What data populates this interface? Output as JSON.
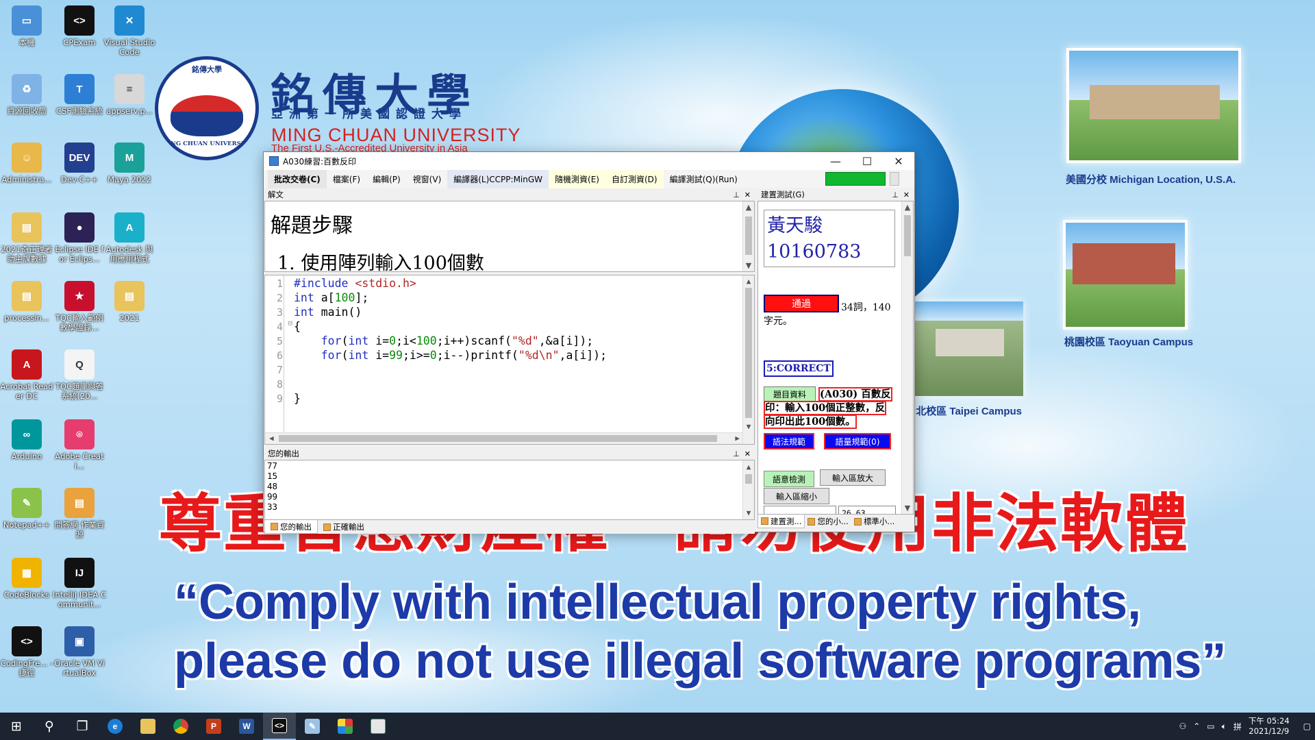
{
  "wallpaper": {
    "university_cn": "銘傳大學",
    "university_sub": "亞洲第一所美國認證大學",
    "university_en": "MING CHUAN UNIVERSITY",
    "university_en2": "The First U.S.-Accredited University in Asia",
    "seal_top": "銘傳大學",
    "seal_bottom": "MING CHUAN UNIVERSITY",
    "campus_michigan": "美國分校 Michigan Location, U.S.A.",
    "campus_taoyuan": "桃園校區 Taoyuan Campus",
    "campus_taipei": "台北校區 Taipei Campus",
    "banner_cn": "尊重智慧財產權　請勿使用非法軟體",
    "banner_en_line1": "“Comply with intellectual property rights,",
    "banner_en_line2": "please do not use illegal software programs”"
  },
  "desktop_icons": [
    {
      "label": "本機",
      "icon": "pc-icon",
      "color": "#4a90d9",
      "glyph": "▭"
    },
    {
      "label": "CPExam",
      "icon": "cpexam-icon",
      "color": "#111111",
      "glyph": "<>"
    },
    {
      "label": "Visual Studio Code",
      "icon": "vscode-icon",
      "color": "#1f8ad2",
      "glyph": "✕"
    },
    {
      "label": "資源回收筒",
      "icon": "recycle-bin-icon",
      "color": "#7fb2e5",
      "glyph": "♻"
    },
    {
      "label": "CSF測驗系統",
      "icon": "csf-icon",
      "color": "#2c7fd4",
      "glyph": "T"
    },
    {
      "label": "appserv.p...",
      "icon": "file-icon",
      "color": "#d8d8d8",
      "glyph": "≡"
    },
    {
      "label": "Administra...",
      "icon": "user-folder-icon",
      "color": "#e8b84a",
      "glyph": "☺"
    },
    {
      "label": "Dev-C++",
      "icon": "devcpp-icon",
      "color": "#233f8f",
      "glyph": "DEV"
    },
    {
      "label": "Maya 2022",
      "icon": "maya-icon",
      "color": "#1aa19a",
      "glyph": "M"
    },
    {
      "label": "2021奇正理者助主課數據",
      "icon": "folder-icon",
      "color": "#e9c35c",
      "glyph": "▤"
    },
    {
      "label": "Eclipse IDE for Eclips...",
      "icon": "eclipse-icon",
      "color": "#2c2255",
      "glyph": "●"
    },
    {
      "label": "Autodesk 與用應用程式",
      "icon": "autodesk-icon",
      "color": "#1bb0c9",
      "glyph": "A"
    },
    {
      "label": "processin...",
      "icon": "folder-icon",
      "color": "#e9c35c",
      "glyph": "▤"
    },
    {
      "label": "TQC輸入範例教學證錄...",
      "icon": "tqc-flag-icon",
      "color": "#c8102e",
      "glyph": "★"
    },
    {
      "label": "2021",
      "icon": "folder-icon",
      "color": "#e9c35c",
      "glyph": "▤"
    },
    {
      "label": "Acrobat Reader DC",
      "icon": "acrobat-icon",
      "color": "#c8161d",
      "glyph": "A"
    },
    {
      "label": "TQC題庫與答系統(20...",
      "icon": "tqc-2016-icon",
      "color": "#f4f4f4",
      "glyph": "Q"
    },
    {
      "label": "Arduino",
      "icon": "arduino-icon",
      "color": "#00979c",
      "glyph": "∞"
    },
    {
      "label": "Adobe Creati...",
      "icon": "creative-cloud-icon",
      "color": "#e63c6e",
      "glyph": "⌾"
    },
    {
      "label": "Notepad++",
      "icon": "notepadpp-icon",
      "color": "#8bc34a",
      "glyph": "✎"
    },
    {
      "label": "問答網 作業資源",
      "icon": "folder-icon",
      "color": "#e9a23c",
      "glyph": "▤"
    },
    {
      "label": "CodeBlocks",
      "icon": "codeblocks-icon",
      "color": "#f0b400",
      "glyph": "▦"
    },
    {
      "label": "IntelliJ IDEA Communit...",
      "icon": "intellij-icon",
      "color": "#111111",
      "glyph": "IJ"
    },
    {
      "label": "CodingFre... - 捷徑",
      "icon": "codingfree-icon",
      "color": "#111111",
      "glyph": "<>"
    },
    {
      "label": "Oracle VM VirtualBox",
      "icon": "virtualbox-icon",
      "color": "#2d5ea8",
      "glyph": "▣"
    }
  ],
  "window": {
    "title": "A030練習:百數反印",
    "minimize": "—",
    "maximize": "☐",
    "close": "✕",
    "menu": [
      {
        "label": "批改交卷(C)",
        "style": "bold"
      },
      {
        "label": "檔案(F)",
        "style": ""
      },
      {
        "label": "編輯(P)",
        "style": ""
      },
      {
        "label": "視窗(V)",
        "style": ""
      },
      {
        "label": "編譯器(L)CCPP:MinGW",
        "style": "hl2"
      },
      {
        "label": "隨機測資(E)",
        "style": "hl"
      },
      {
        "label": "自訂測資(D)",
        "style": "hl"
      },
      {
        "label": "編譯測試(Q)(Run)",
        "style": ""
      }
    ],
    "progress_percent": 86
  },
  "problem_pane": {
    "title": "解文",
    "heading": "解題步驟",
    "step": "1. 使用陣列輸入100個數"
  },
  "editor": {
    "line_numbers": [
      "1",
      "2",
      "3",
      "4",
      "5",
      "6",
      "7",
      "8",
      "9"
    ],
    "fold_marker": "⊟"
  },
  "output_pane": {
    "title": "您的輸出",
    "lines": [
      "77",
      "15",
      "48",
      "99",
      "33"
    ]
  },
  "bottom_tabs": [
    {
      "label": "您的輸出",
      "active": true
    },
    {
      "label": "正確輸出",
      "active": false
    }
  ],
  "test_pane": {
    "title": "建置測試(G)",
    "student_name": "黃天駿",
    "student_id": "10160783",
    "pass_label": "通過",
    "pass_info_line1": "34詞，140",
    "pass_info_line2": "字元。",
    "correct_label": "5:CORRECT",
    "question_info_button": "題目資料",
    "question_desc_line1": "(A030) 百數反",
    "question_desc_line2": "印：輸入100個正整數，反",
    "question_desc_line3": "向印出此100個數。",
    "syntax_rule_button": "語法規範",
    "quota_rule_button": "語量規範(0)",
    "syntax_check_button": "語意檢測",
    "enlarge_input_button": "輸入區放大",
    "shrink_input_button": "輸入區縮小",
    "mini_value": "26  63",
    "tabs": [
      "建置測...",
      "您的小...",
      "標準小..."
    ]
  },
  "taskbar": {
    "time": "下午 05:24",
    "date": "2021/12/9"
  }
}
